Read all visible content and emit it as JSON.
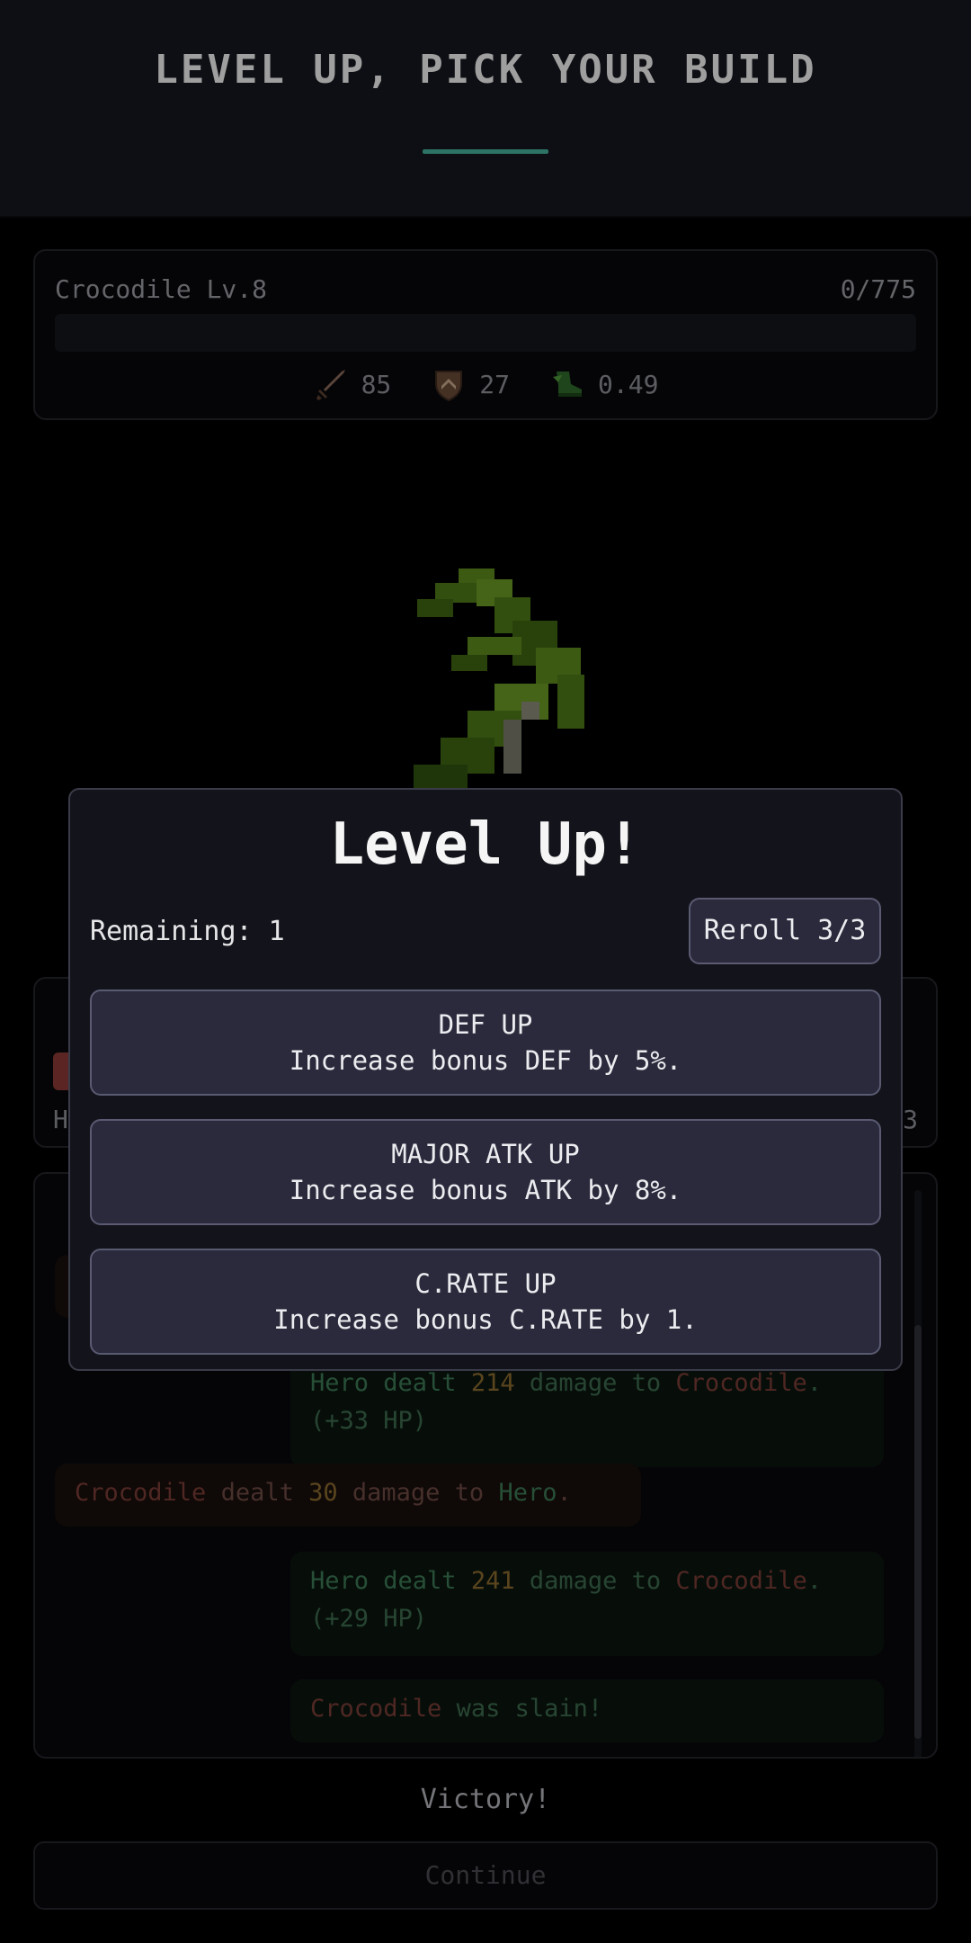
{
  "header": {
    "title": "LEVEL UP, PICK YOUR BUILD"
  },
  "enemy": {
    "name": "Crocodile Lv.8",
    "xp": "0/775",
    "xp_fraction": 0,
    "stats": [
      {
        "icon": "sword-icon",
        "value": "85"
      },
      {
        "icon": "shield-icon",
        "value": "27"
      },
      {
        "icon": "boot-icon",
        "value": "0.49"
      }
    ]
  },
  "log": {
    "entries": [
      {
        "side": "hero",
        "prefix": "Hero dealt ",
        "num": "214",
        "mid": " damage to ",
        "target": "Crocodile",
        "suffix": ".",
        "line2": "(+33 HP)"
      },
      {
        "side": "enemy",
        "prefix": "Crocodile",
        "mid": " dealt ",
        "num": "30",
        "mid2": " damage to ",
        "target": "Hero",
        "suffix": "."
      },
      {
        "side": "hero",
        "prefix": "Hero dealt ",
        "num": "241",
        "mid": " damage to ",
        "target": "Crocodile",
        "suffix": ".",
        "line2": "(+29 HP)"
      },
      {
        "side": "hero",
        "prefix": "Crocodile",
        "mid": " was slain!"
      }
    ]
  },
  "victory": "Victory!",
  "continue_label": "Continue",
  "modal": {
    "title": "Level Up!",
    "remaining": "Remaining: 1",
    "reroll": "Reroll 3/3",
    "choices": [
      {
        "title": "DEF UP",
        "desc": "Increase bonus DEF by 5%."
      },
      {
        "title": "MAJOR ATK UP",
        "desc": "Increase bonus ATK by 8%."
      },
      {
        "title": "C.RATE UP",
        "desc": "Increase bonus C.RATE by 1."
      }
    ]
  },
  "colors": {
    "accent": "#45b39d",
    "button": "#2a2a3c",
    "enemy_text": "#7a3c36",
    "hero_text": "#3d7a55"
  }
}
